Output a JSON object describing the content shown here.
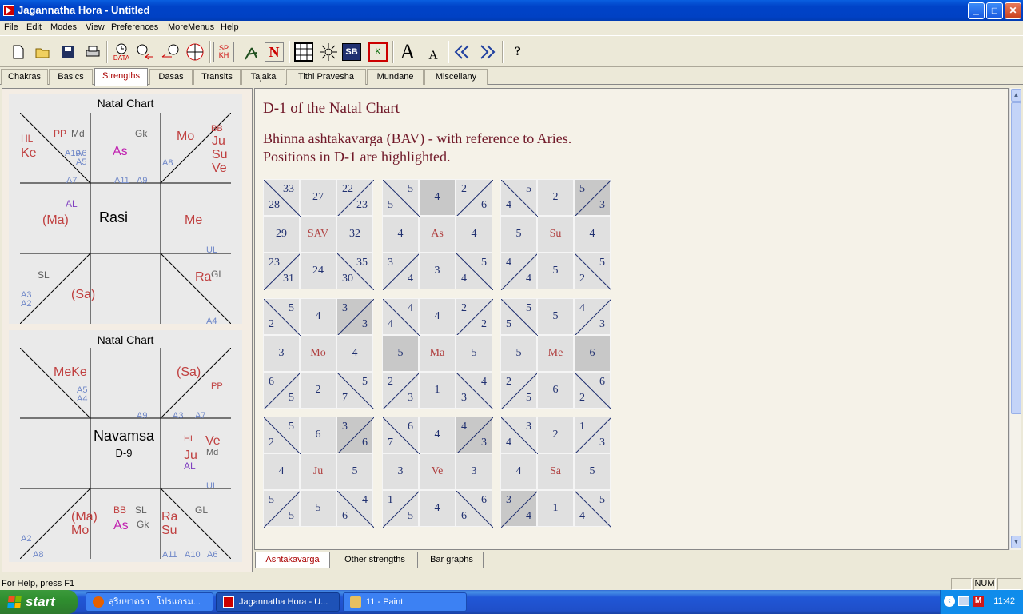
{
  "window": {
    "title": "Jagannatha Hora - Untitled"
  },
  "menu": [
    "File",
    "Edit",
    "Modes",
    "View",
    "Preferences",
    "MoreMenus",
    "Help"
  ],
  "toolbar": {
    "data_label": "DATA",
    "sp_top": "SP",
    "sp_bottom": "KH",
    "n_label": "N",
    "sb_label": "SB",
    "k_label": "K",
    "font_big": "A",
    "font_small": "A",
    "help": "?"
  },
  "tabs": [
    "Chakras",
    "Basics",
    "Strengths",
    "Dasas",
    "Transits",
    "Tajaka",
    "Tithi Pravesha",
    "Mundane",
    "Miscellany"
  ],
  "active_tab": "Strengths",
  "rasi_chart": {
    "title": "Natal Chart",
    "center": "Rasi",
    "labels": {
      "hl": "HL",
      "ke": "Ke",
      "pp": "PP",
      "md": "Md",
      "a10": "A10",
      "a6": "A6",
      "a5": "A5",
      "as": "As",
      "gk": "Gk",
      "mo": "Mo",
      "bb": "BB",
      "ju": "Ju",
      "su": "Su",
      "ve": "Ve",
      "a8": "A8",
      "a7": "A7",
      "a11": "A11",
      "a9": "A9",
      "al": "AL",
      "ma": "(Ma)",
      "me": "Me",
      "ul": "UL",
      "sl": "SL",
      "a3": "A3",
      "a2": "A2",
      "sa": "(Sa)",
      "ra": "Ra",
      "gl": "GL",
      "a4": "A4"
    }
  },
  "navamsa_chart": {
    "title": "Natal Chart",
    "center": "Navamsa",
    "sub": "D-9",
    "labels": {
      "meke": "MeKe",
      "a5": "A5",
      "a4": "A4",
      "sa": "(Sa)",
      "pp": "PP",
      "a9": "A9",
      "a3": "A3",
      "a7": "A7",
      "hl": "HL",
      "ve": "Ve",
      "ju": "Ju",
      "md": "Md",
      "al": "AL",
      "ul": "UL",
      "ma": "(Ma)",
      "mo": "Mo",
      "bb": "BB",
      "sl": "SL",
      "as": "As",
      "gk": "Gk",
      "ra": "Ra",
      "su": "Su",
      "gl": "GL",
      "a2": "A2",
      "a8": "A8",
      "a11": "A11",
      "a10": "A10",
      "a6": "A6"
    }
  },
  "content": {
    "title": "D-1 of the Natal Chart",
    "line1": "Bhinna ashtakavarga (BAV) - with reference to Aries.",
    "line2": "Positions in D-1 are highlighted."
  },
  "bav_grids": [
    {
      "center": "SAV",
      "cells": [
        [
          "33",
          "28"
        ],
        "27",
        [
          "22",
          "23"
        ],
        "29",
        "32",
        [
          "23",
          "31"
        ],
        "24",
        [
          "35",
          "30"
        ]
      ],
      "hl": []
    },
    {
      "center": "As",
      "cells": [
        [
          "5",
          "5"
        ],
        "4",
        [
          "2",
          "6"
        ],
        "4",
        "4",
        [
          "3",
          "4"
        ],
        "3",
        [
          "5",
          "4"
        ]
      ],
      "hl": [
        1
      ]
    },
    {
      "center": "Su",
      "cells": [
        [
          "5",
          "4"
        ],
        "2",
        [
          "5",
          "3"
        ],
        "5",
        "4",
        [
          "4",
          "4"
        ],
        "5",
        [
          "5",
          "2"
        ]
      ],
      "hl": [
        2
      ]
    },
    {
      "center": "Mo",
      "cells": [
        [
          "5",
          "2"
        ],
        "4",
        [
          "3",
          "3"
        ],
        "3",
        "4",
        [
          "6",
          "5"
        ],
        "2",
        [
          "5",
          "7"
        ]
      ],
      "hl": [
        2
      ]
    },
    {
      "center": "Ma",
      "cells": [
        [
          "4",
          "4"
        ],
        "4",
        [
          "2",
          "2"
        ],
        "5",
        "5",
        [
          "2",
          "3"
        ],
        "1",
        [
          "4",
          "3"
        ]
      ],
      "hl": [
        3
      ]
    },
    {
      "center": "Me",
      "cells": [
        [
          "5",
          "5"
        ],
        "5",
        [
          "4",
          "3"
        ],
        "5",
        "6",
        [
          "2",
          "5"
        ],
        "6",
        [
          "6",
          "2"
        ]
      ],
      "hl": [
        4
      ]
    },
    {
      "center": "Ju",
      "cells": [
        [
          "5",
          "2"
        ],
        "6",
        [
          "3",
          "6"
        ],
        "4",
        "5",
        [
          "5",
          "5"
        ],
        "5",
        [
          "4",
          "6"
        ]
      ],
      "hl": [
        2
      ]
    },
    {
      "center": "Ve",
      "cells": [
        [
          "6",
          "7"
        ],
        "4",
        [
          "4",
          "3"
        ],
        "3",
        "3",
        [
          "1",
          "5"
        ],
        "4",
        [
          "6",
          "6"
        ]
      ],
      "hl": [
        2
      ]
    },
    {
      "center": "Sa",
      "cells": [
        [
          "3",
          "4"
        ],
        "2",
        [
          "1",
          "3"
        ],
        "4",
        "5",
        [
          "3",
          "4"
        ],
        "1",
        [
          "5",
          "4"
        ]
      ],
      "hl": [
        5
      ]
    }
  ],
  "bottom_tabs": [
    "Ashtakavarga",
    "Other strengths",
    "Bar graphs"
  ],
  "status": {
    "help": "For Help, press F1",
    "num": "NUM"
  },
  "taskbar": {
    "start": "start",
    "items": [
      "สุริยยาตรา : โปรแกรม...",
      "Jagannatha Hora - U...",
      "11 - Paint"
    ],
    "clock": "11:42"
  }
}
